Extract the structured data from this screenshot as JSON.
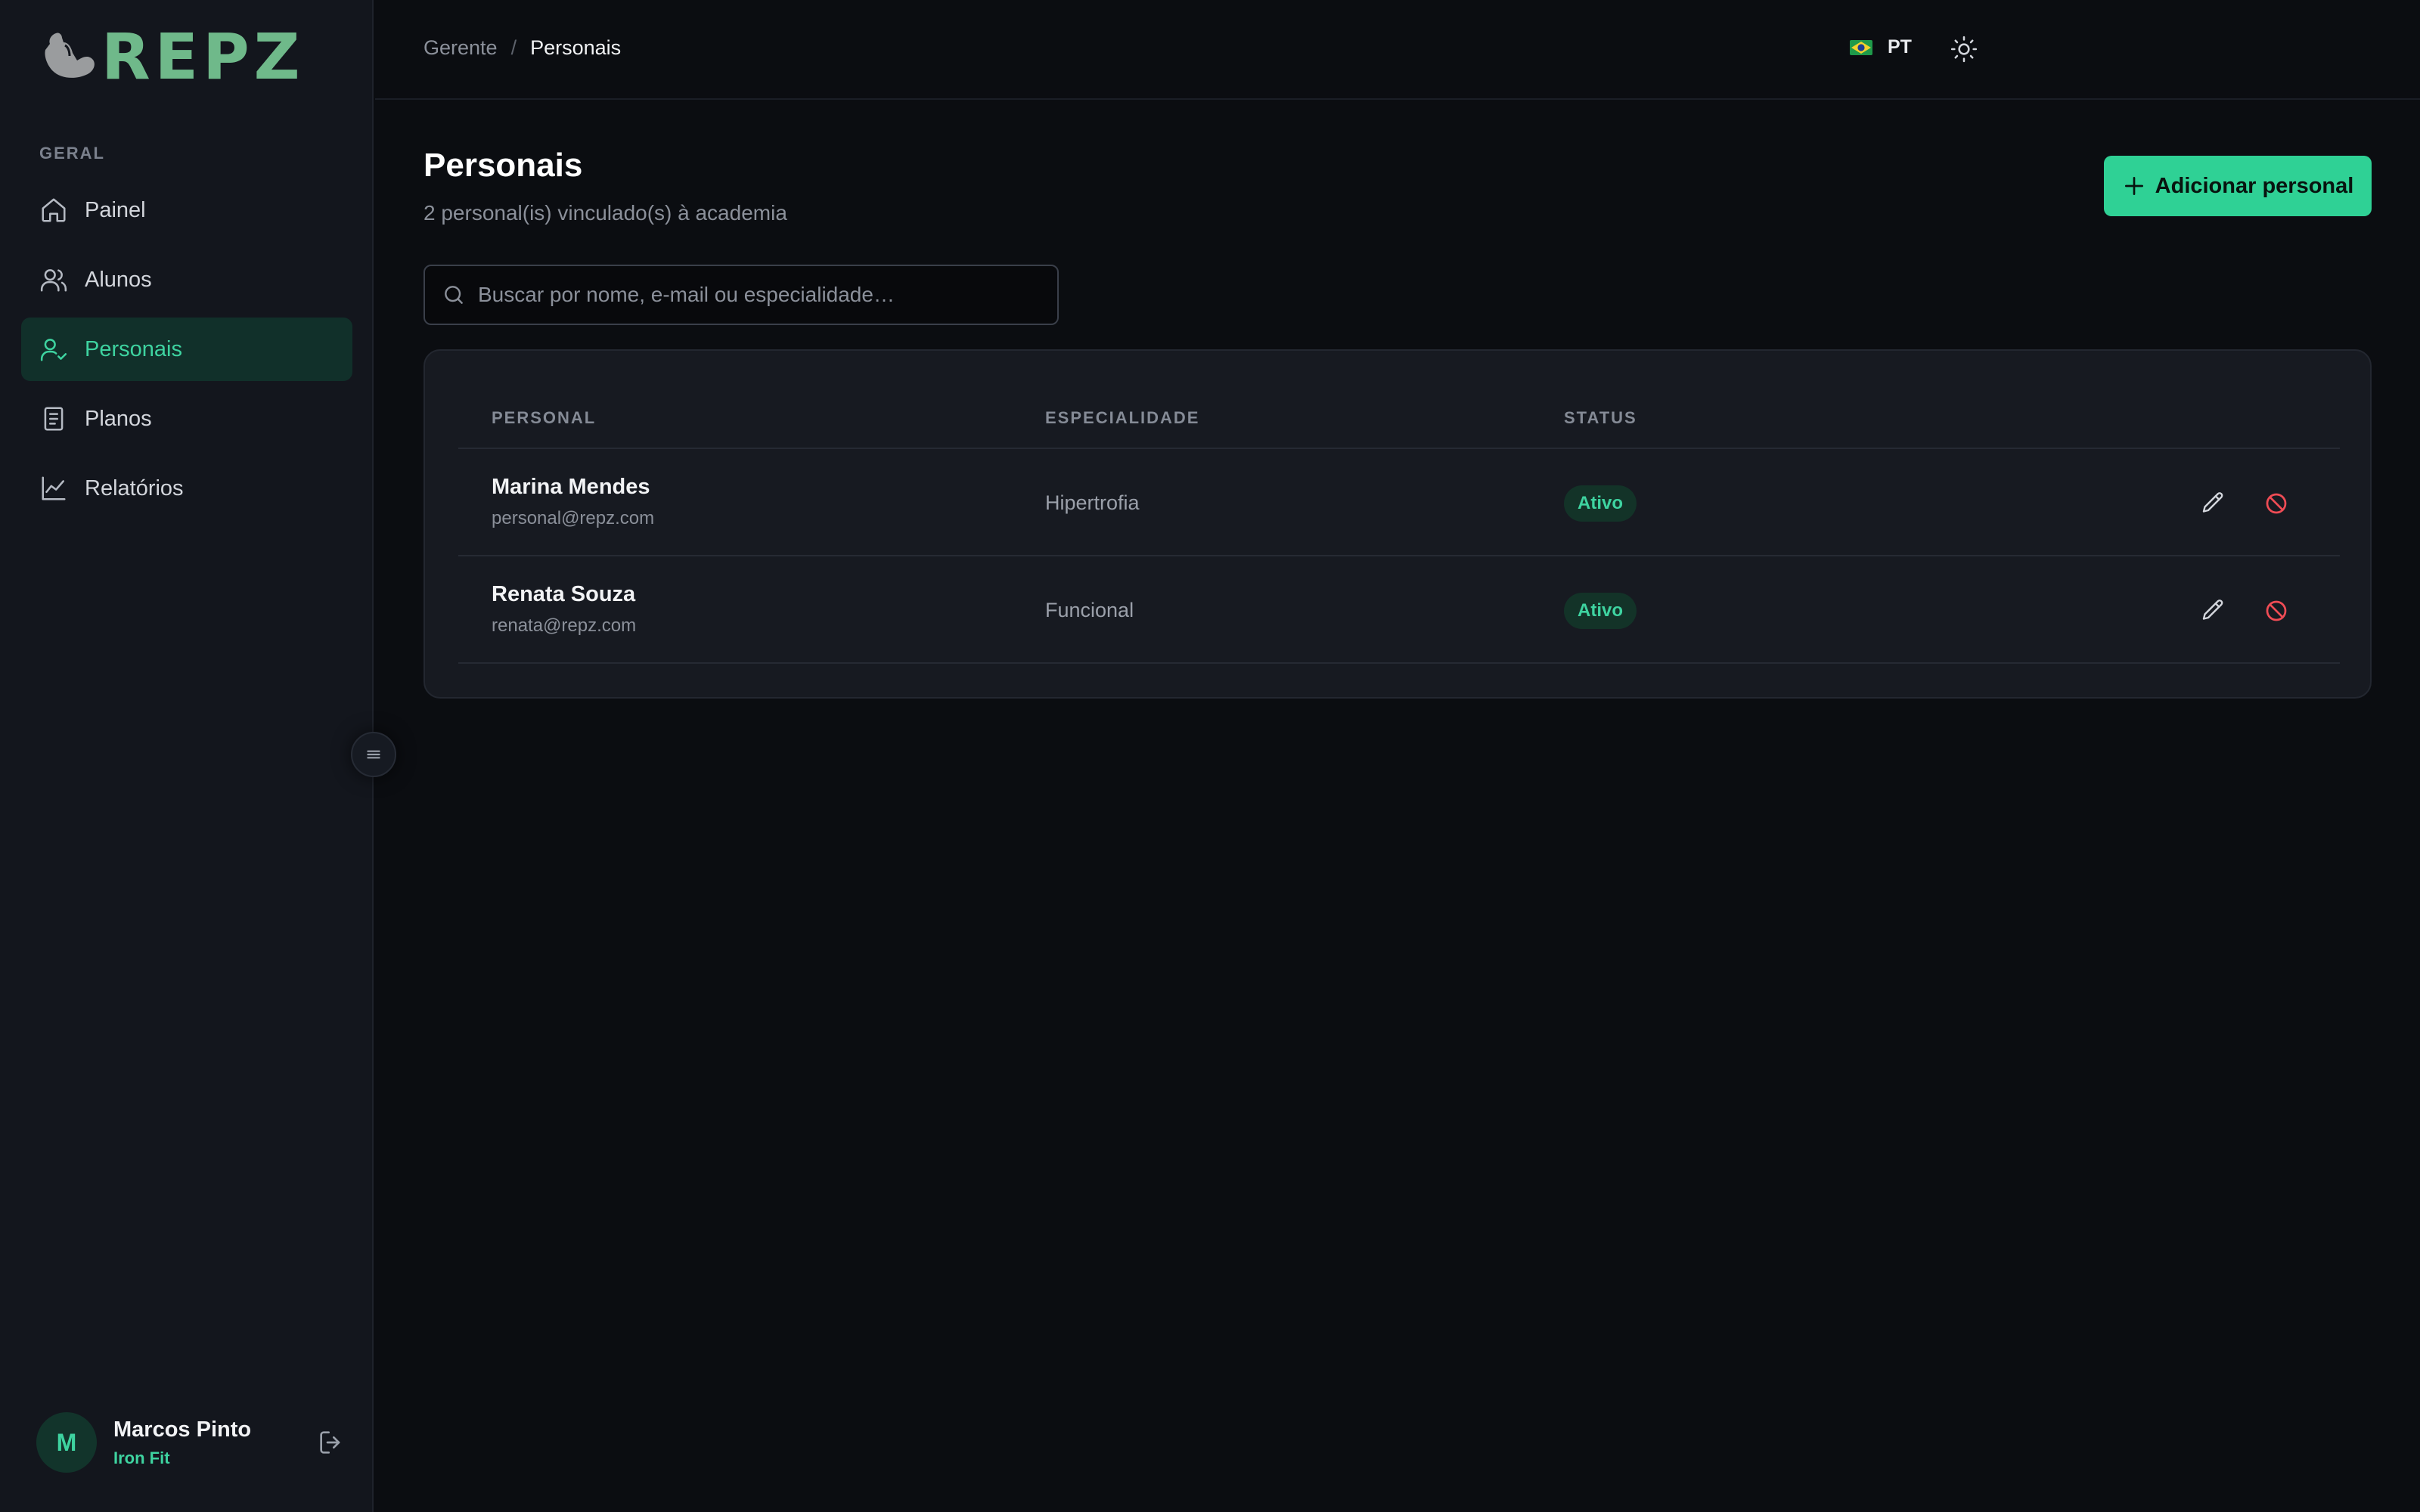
{
  "brand": {
    "name": "REPZ",
    "accent": "#3ed3a0",
    "logo_color": "#6fb98a"
  },
  "sidebar": {
    "section_label": "GERAL",
    "items": [
      {
        "label": "Painel",
        "icon": "home-icon",
        "active": false
      },
      {
        "label": "Alunos",
        "icon": "users-icon",
        "active": false
      },
      {
        "label": "Personais",
        "icon": "user-check-icon",
        "active": true
      },
      {
        "label": "Planos",
        "icon": "document-icon",
        "active": false
      },
      {
        "label": "Relatórios",
        "icon": "chart-line-icon",
        "active": false
      }
    ],
    "user": {
      "initial": "M",
      "name": "Marcos Pinto",
      "gym": "Iron Fit"
    }
  },
  "topbar": {
    "breadcrumb": {
      "parent": "Gerente",
      "separator": "/",
      "current": "Personais"
    },
    "language": "PT",
    "theme_icon": "sun-icon"
  },
  "main": {
    "title": "Personais",
    "subtitle": "2 personal(is) vinculado(s) à academia",
    "add_button_label": "Adicionar personal",
    "search_placeholder": "Buscar por nome, e-mail ou especialidade…",
    "table": {
      "headers": [
        "PERSONAL",
        "ESPECIALIDADE",
        "STATUS"
      ],
      "rows": [
        {
          "name": "Marina Mendes",
          "email": "personal@repz.com",
          "specialty": "Hipertrofia",
          "status": "Ativo"
        },
        {
          "name": "Renata Souza",
          "email": "renata@repz.com",
          "specialty": "Funcional",
          "status": "Ativo"
        }
      ]
    }
  }
}
